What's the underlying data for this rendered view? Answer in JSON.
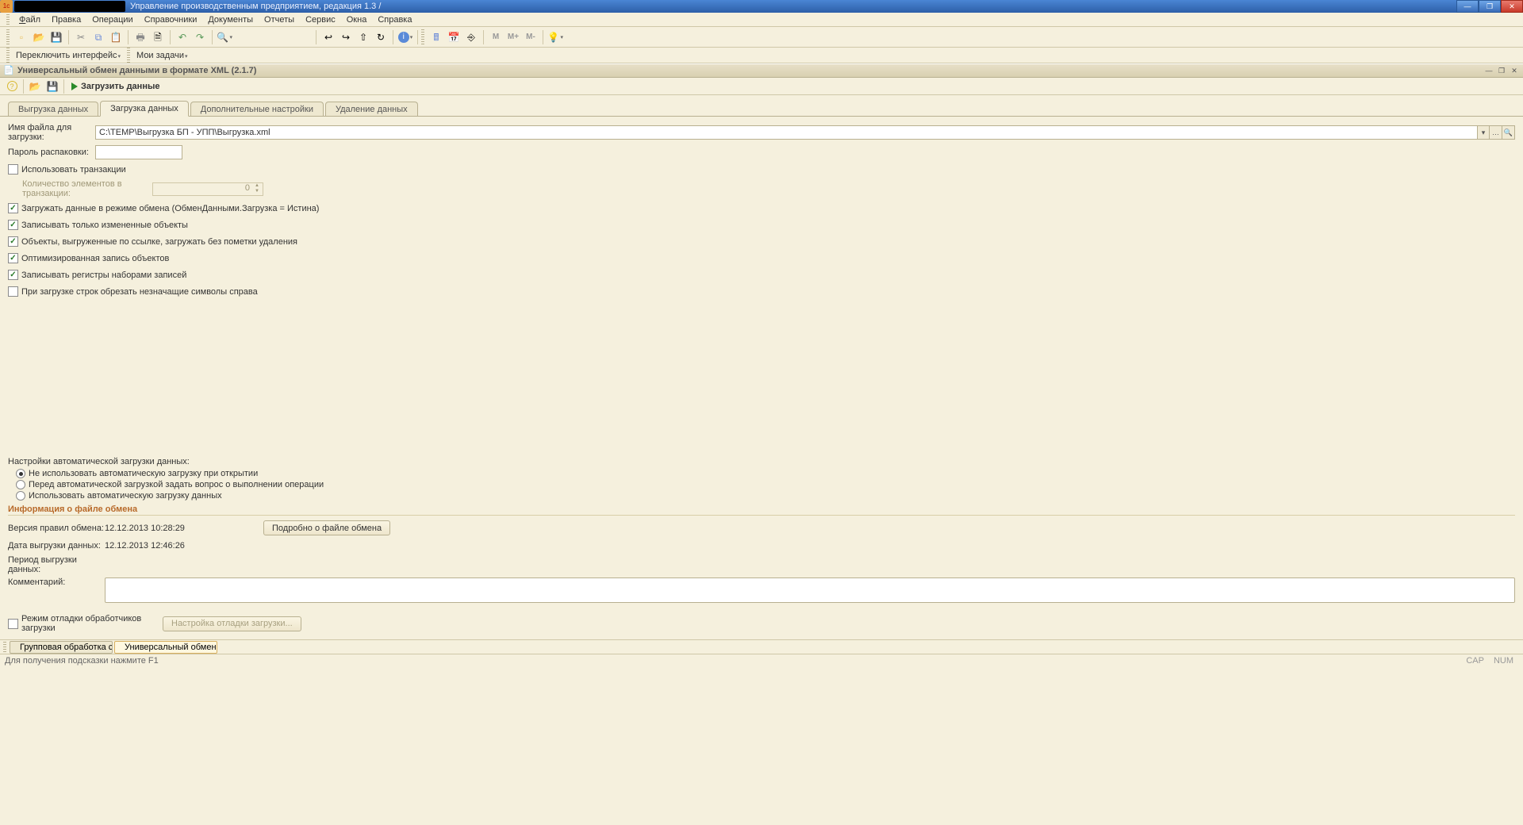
{
  "titlebar": {
    "title": "Управление производственным предприятием, редакция 1.3 /"
  },
  "menu": {
    "file": "Файл",
    "edit": "Правка",
    "ops": "Операции",
    "refs": "Справочники",
    "docs": "Документы",
    "reports": "Отчеты",
    "service": "Сервис",
    "windows": "Окна",
    "help": "Справка"
  },
  "toolbar2": {
    "switch_iface": "Переключить интерфейс",
    "my_tasks": "Мои задачи"
  },
  "toolbar_m": {
    "m": "M",
    "mplus": "M+",
    "mminus": "M-"
  },
  "subwin": {
    "title": "Универсальный обмен данными в формате XML (2.1.7)",
    "run": "Загрузить данные"
  },
  "tabs": {
    "t1": "Выгрузка данных",
    "t2": "Загрузка данных",
    "t3": "Дополнительные настройки",
    "t4": "Удаление данных"
  },
  "form": {
    "file_label": "Имя файла для загрузки:",
    "file_value": "C:\\TEMP\\Выгрузка БП - УПП\\Выгрузка.xml",
    "pwd_label": "Пароль распаковки:",
    "chk_trans": "Использовать транзакции",
    "trans_count_label": "Количество элементов в транзакции:",
    "trans_count_value": "0",
    "chk_exchange": "Загружать данные в режиме обмена (ОбменДанными.Загрузка = Истина)",
    "chk_changed": "Записывать только измененные объекты",
    "chk_ref": "Объекты, выгруженные по ссылке, загружать без пометки удаления",
    "chk_opt": "Оптимизированная запись объектов",
    "chk_reg": "Записывать регистры наборами записей",
    "chk_trim": "При загрузке строк обрезать незначащие символы справа"
  },
  "auto": {
    "heading": "Настройки автоматической загрузки данных:",
    "r1": "Не использовать автоматическую загрузку при открытии",
    "r2": "Перед автоматической загрузкой задать вопрос о выполнении операции",
    "r3": "Использовать автоматическую загрузку данных"
  },
  "fileinfo": {
    "heading": "Информация о файле обмена",
    "rules_ver_label": "Версия правил обмена:",
    "rules_ver_value": "12.12.2013 10:28:29",
    "export_date_label": "Дата выгрузки данных:",
    "export_date_value": "12.12.2013 12:46:26",
    "period_label": "Период выгрузки данных:",
    "comment_label": "Комментарий:",
    "details_btn": "Подробно о файле обмена"
  },
  "debug": {
    "chk": "Режим отладки обработчиков загрузки",
    "btn": "Настройка отладки загрузки..."
  },
  "taskbar": {
    "t1": "Групповая обработка спра...",
    "t2": "Универсальный обмен дан..."
  },
  "status": {
    "hint": "Для получения подсказки нажмите F1",
    "cap": "CAP",
    "num": "NUM"
  }
}
